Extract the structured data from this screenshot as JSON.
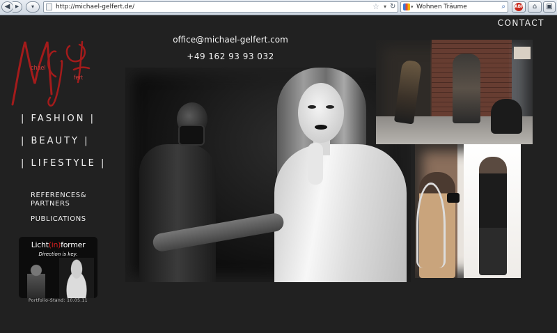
{
  "browser": {
    "url": "http://michael-gelfert.de/",
    "search_value": "Wohnen Träume",
    "icons": [
      "back-arrow-icon",
      "forward-arrow-icon",
      "bookmark-star-icon",
      "reload-icon",
      "google-icon",
      "magnifier-icon",
      "adblock-icon",
      "home-icon",
      "addon-icon"
    ]
  },
  "site": {
    "contact_label": "CONTACT",
    "logo": {
      "first": "Mi",
      "last": "Gel",
      "small_first": "chael",
      "small_last": "fert",
      "color": "#a31b1b"
    },
    "nav": [
      {
        "label": "|  FASHION  |"
      },
      {
        "label": "|  BEAUTY  |"
      },
      {
        "label": "|  LIFESTYLE  |"
      }
    ],
    "subnav": {
      "references_line1": "REFERENCES&",
      "references_line2": "PARTNERS",
      "publications": "PUBLICATIONS"
    },
    "email": "office@michael-gelfert.com",
    "phone": "+49 162 93 93 032",
    "banner": {
      "title_pre": "Licht",
      "title_mid": "(in)",
      "title_post": "former",
      "subtitle": "Direction is key.",
      "accent": "#d21f1f"
    },
    "portfolio_stand": "Portfolio-Stand: 10.05.11"
  }
}
